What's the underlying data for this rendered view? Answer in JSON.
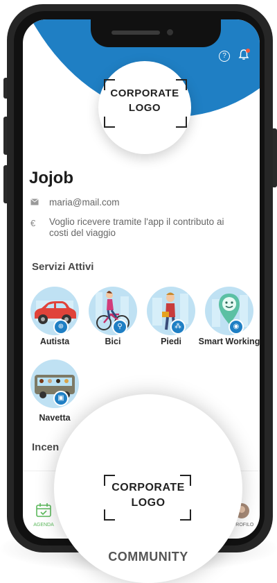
{
  "header": {
    "help_icon": "help-circle-icon",
    "notification_icon": "bell-icon",
    "accent_color": "#1f7fc4"
  },
  "corporate_logo": {
    "line1": "CORPORATE",
    "line2": "LOGO"
  },
  "profile": {
    "name": "Jojob",
    "email": "maria@mail.com",
    "contribution_text": "Voglio ricevere tramite l'app il contributo ai costi del viaggio",
    "contribution_line1": "Voglio ricevere tramite l'app il contributo ai",
    "contribution_line2": "costi del viaggio",
    "email_icon_glyph": "✉",
    "currency_icon_glyph": "€"
  },
  "services": {
    "title": "Servizi Attivi",
    "items": [
      {
        "label": "Autista",
        "icon": "car-icon"
      },
      {
        "label": "Bici",
        "icon": "bicycle-icon"
      },
      {
        "label": "Piedi",
        "icon": "walking-icon"
      },
      {
        "label": "Smart Working",
        "icon": "smart-working-icon"
      },
      {
        "label": "Navetta",
        "icon": "shuttle-bus-icon"
      }
    ]
  },
  "incentives": {
    "title_partial": "Incen"
  },
  "bottom_nav": {
    "agenda_label": "AGENDA",
    "profile_label": "PROFILO"
  },
  "overlay": {
    "label": "COMMUNITY"
  }
}
